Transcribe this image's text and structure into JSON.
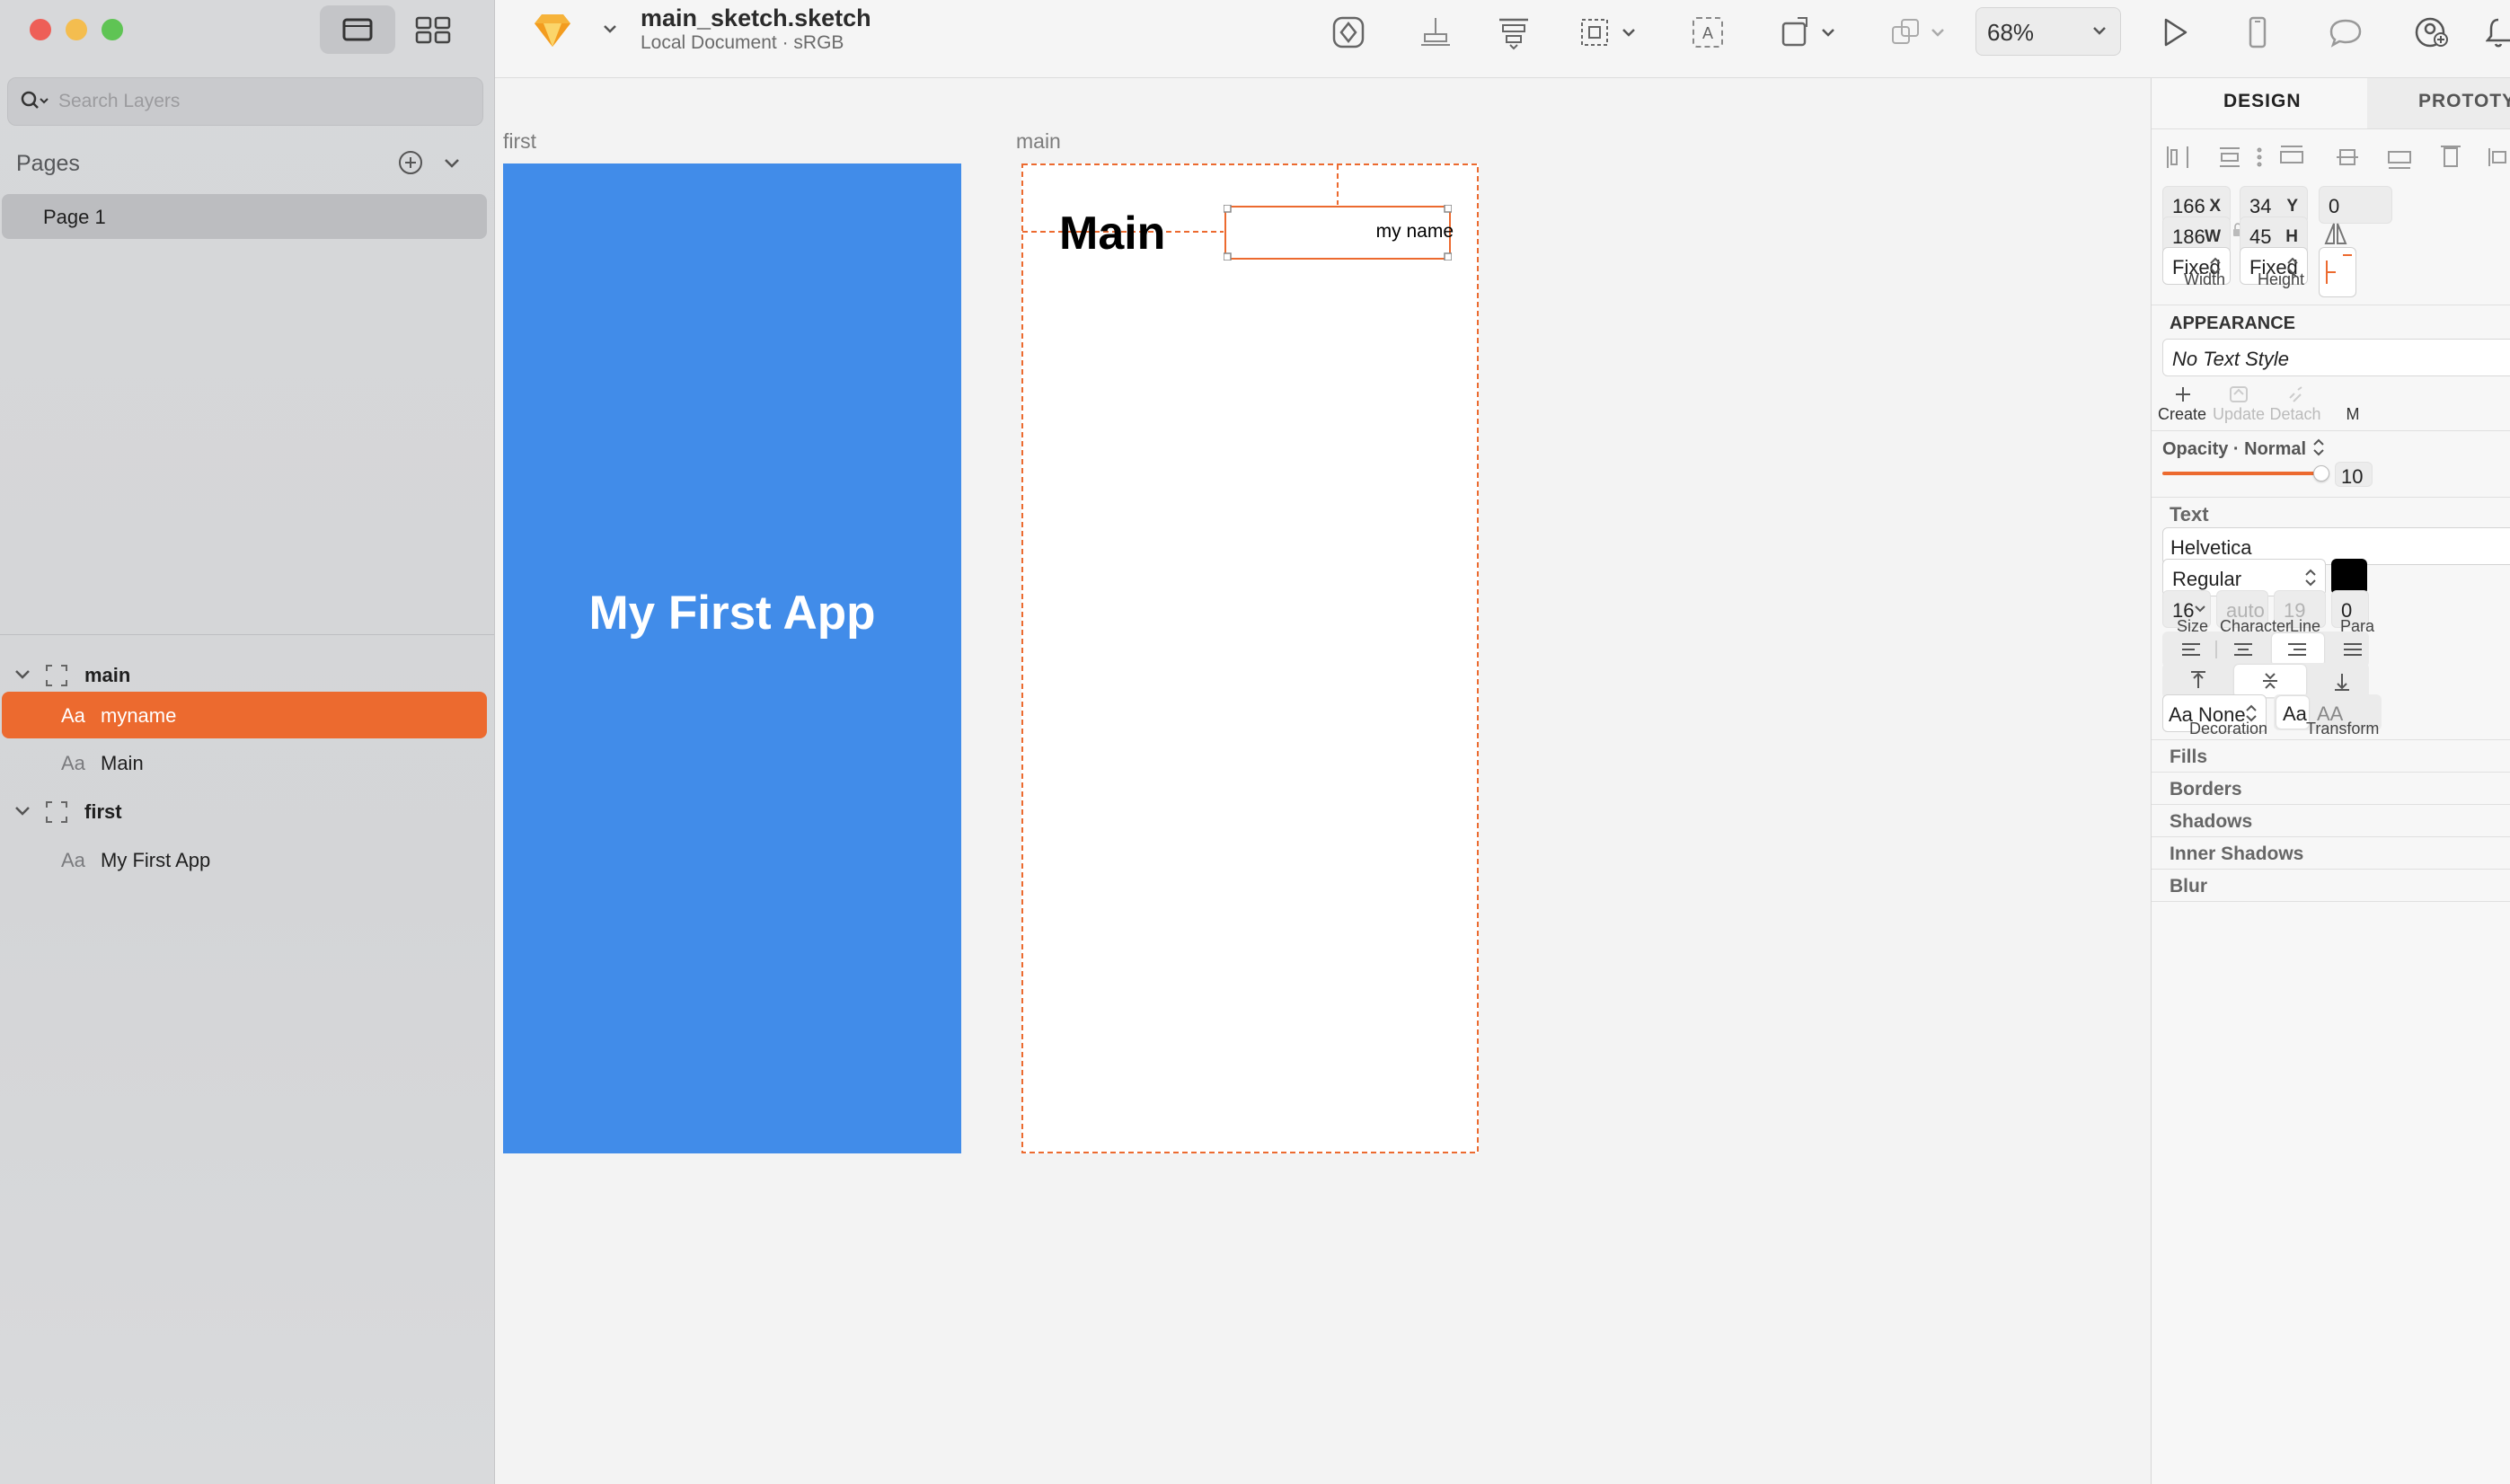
{
  "window": {
    "title": "main_sketch.sketch",
    "subtitle": "Local Document · sRGB"
  },
  "toolbar": {
    "zoom": "68%"
  },
  "sidebar": {
    "search_placeholder": "Search Layers",
    "pages_title": "Pages",
    "pages": [
      {
        "label": "Page 1",
        "selected": true
      }
    ],
    "layers": [
      {
        "label": "main",
        "type": "artboard"
      },
      {
        "label": "myname",
        "type": "text",
        "selected": true,
        "icon": "Aa"
      },
      {
        "label": "Main",
        "type": "text",
        "icon": "Aa"
      },
      {
        "label": "first",
        "type": "artboard"
      },
      {
        "label": "My First App",
        "type": "text",
        "icon": "Aa"
      }
    ]
  },
  "canvas": {
    "first": {
      "label": "first",
      "text": "My First App",
      "color": "#418ce9"
    },
    "main": {
      "label": "main",
      "heading": "Main",
      "myname_text": "my name"
    },
    "selection_color": "#ec6a2f"
  },
  "inspector": {
    "tabs": [
      "DESIGN",
      "PROTOTYPE"
    ],
    "x": "166",
    "x_key": "X",
    "y": "34",
    "y_key": "Y",
    "rotation": "0",
    "w": "186",
    "w_key": "W",
    "h": "45",
    "h_key": "H",
    "width_mode": "Fixed",
    "height_mode": "Fixed",
    "width_caption": "Width",
    "height_caption": "Height",
    "appearance_title": "APPEARANCE",
    "text_style": "No Text Style",
    "style_actions": [
      "Create",
      "Update",
      "Detach",
      "M"
    ],
    "opacity_label": "Opacity · Normal",
    "opacity_value": "10",
    "opacity_level": 1.0,
    "text_title": "Text",
    "font": "Helvetica",
    "weight": "Regular",
    "text_color": "#000000",
    "size": "16",
    "character": "auto",
    "line": "19",
    "paragraph": "0",
    "size_caption": "Size",
    "character_caption": "Character",
    "line_caption": "Line",
    "paragraph_caption": "Para",
    "decoration": "Aa None",
    "decoration_caption": "Decoration",
    "transform_options": [
      "Aa",
      "AA"
    ],
    "transform_caption": "Transform",
    "sections": [
      "Fills",
      "Borders",
      "Shadows",
      "Inner Shadows",
      "Blur"
    ]
  }
}
